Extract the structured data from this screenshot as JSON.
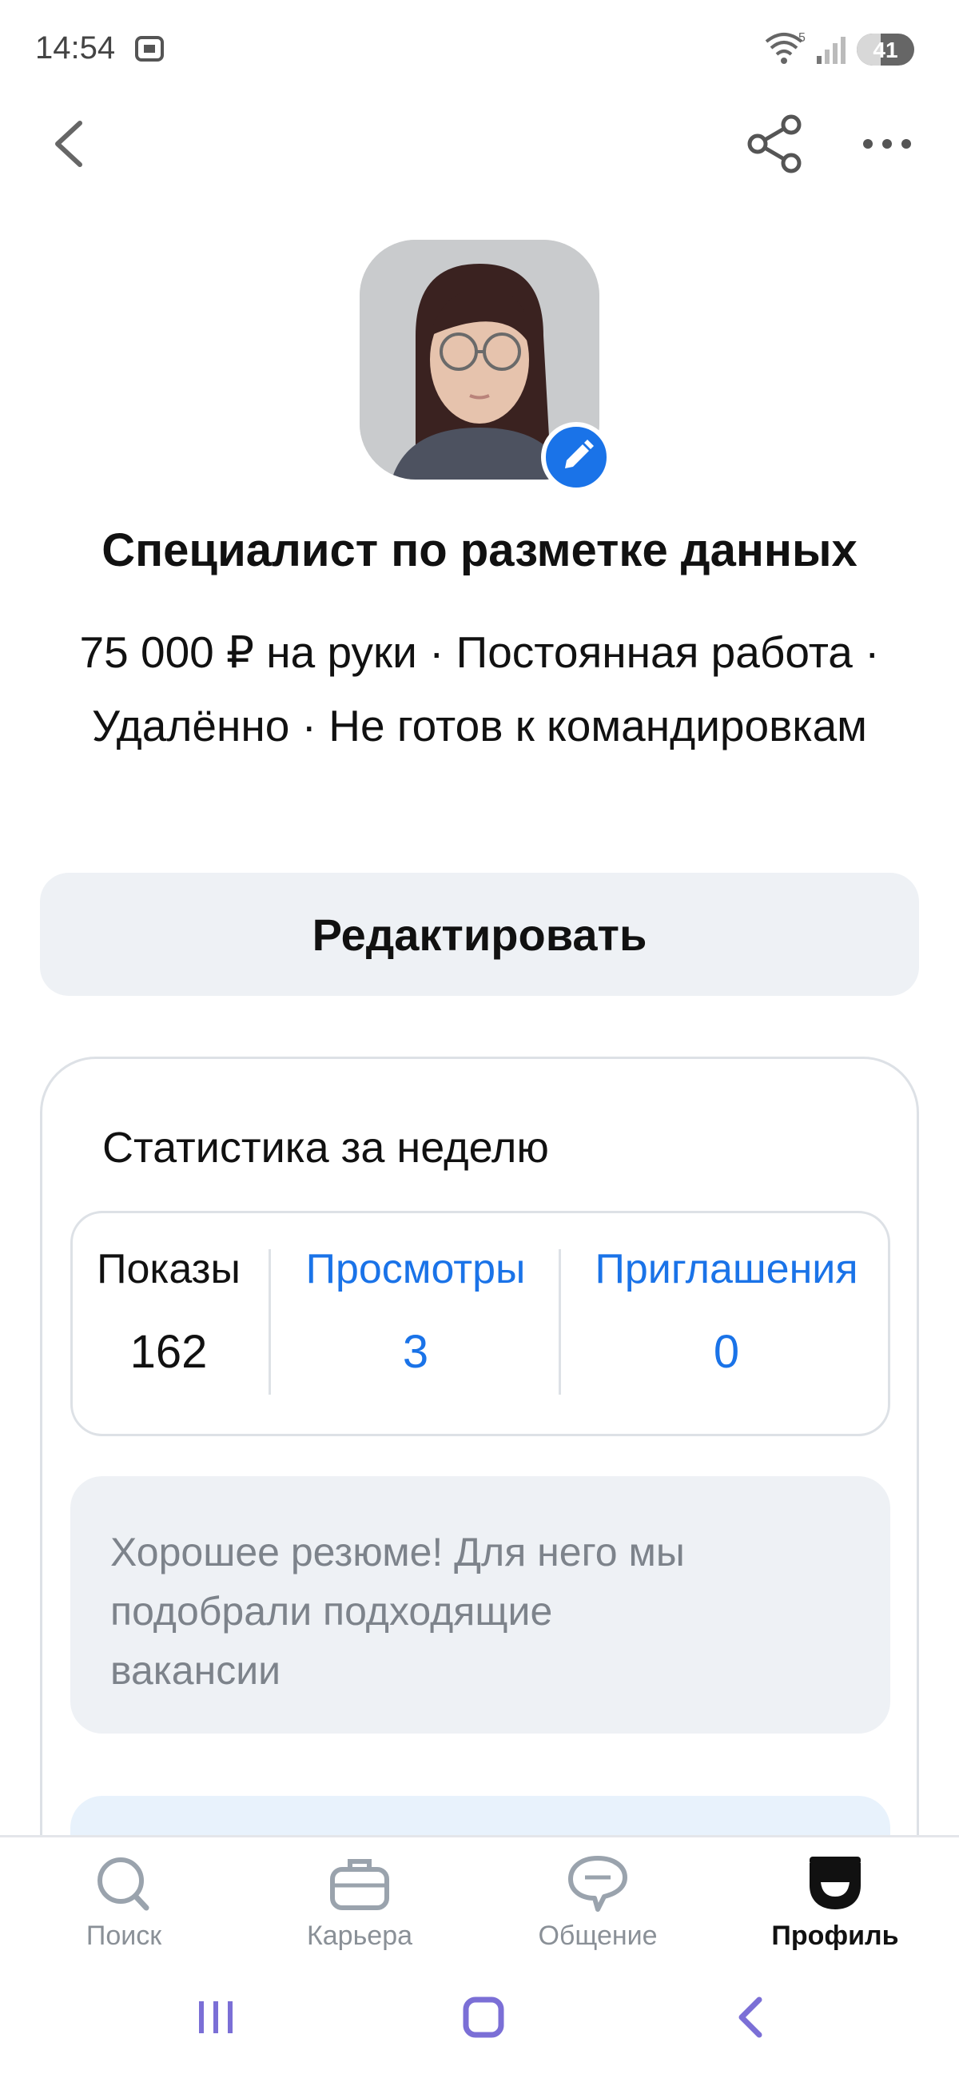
{
  "status_bar": {
    "time": "14:54",
    "wifi_badge": "5",
    "battery": "41",
    "battery_level": 0.41
  },
  "header": {
    "back_icon": "chevron-left-icon",
    "share_icon": "share-icon",
    "more_icon": "more-dots-icon"
  },
  "profile": {
    "title": "Специалист по разметке данных",
    "details": "75 000 ₽ на руки · Постоянная работа · Удалённо · Не готов к командировкам",
    "edit_button_label": "Редактировать"
  },
  "stats": {
    "title": "Статистика за неделю",
    "items": [
      {
        "label": "Показы",
        "value": "162"
      },
      {
        "label": "Просмотры",
        "value": "3"
      },
      {
        "label": "Приглашения",
        "value": "0"
      }
    ],
    "advice": "Хорошее резюме! Для него мы подобрали подходящие вакансии"
  },
  "bottom_nav": {
    "items": [
      {
        "label": "Поиск",
        "icon": "search-icon"
      },
      {
        "label": "Карьера",
        "icon": "briefcase-icon"
      },
      {
        "label": "Общение",
        "icon": "chat-icon"
      },
      {
        "label": "Профиль",
        "icon": "profile-icon",
        "active": true
      }
    ]
  },
  "colors": {
    "accent": "#1a73e8",
    "button_bg": "#eef1f5",
    "muted_text": "#7d838b"
  }
}
